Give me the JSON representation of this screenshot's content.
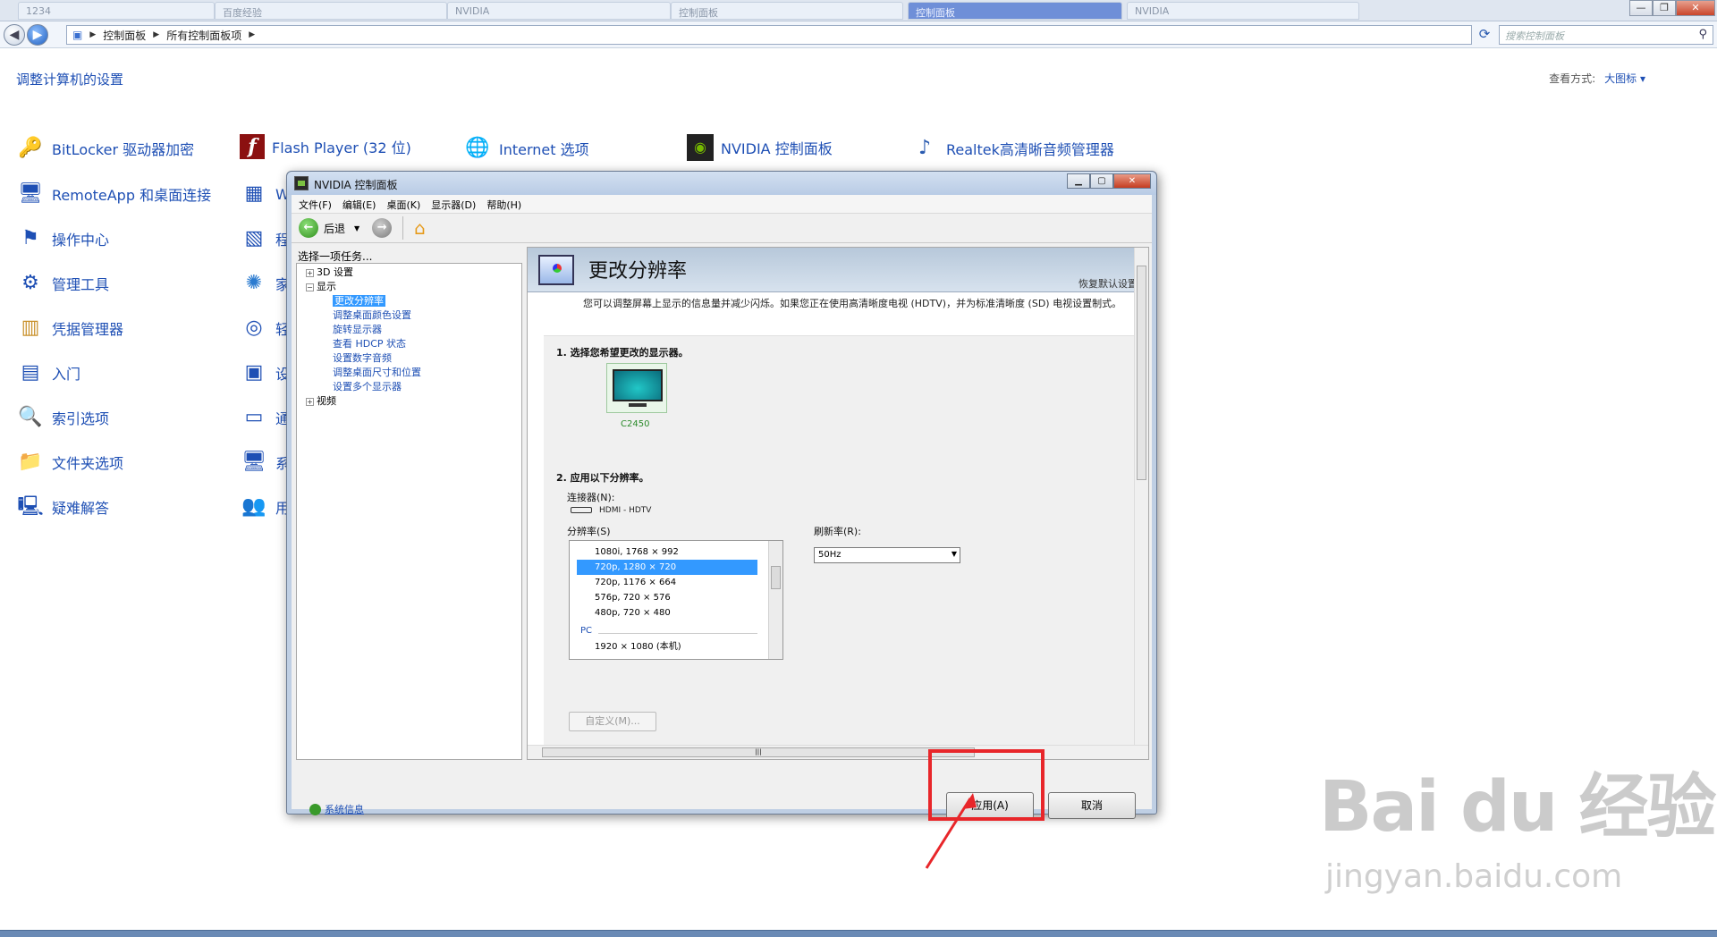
{
  "browser": {
    "tabs": [
      {
        "label": "1234",
        "active": false
      },
      {
        "label": "百度经验",
        "active": false
      },
      {
        "label": "NVIDIA",
        "active": false
      },
      {
        "label": "控制面板",
        "active": false
      },
      {
        "label": "控制面板",
        "active": true
      },
      {
        "label": "NVIDIA",
        "active": false
      }
    ],
    "window_controls": {
      "minimize": "—",
      "maximize": "❐",
      "close": "✕"
    }
  },
  "address": {
    "crumbs": [
      "控制面板",
      "所有控制面板项"
    ],
    "search_placeholder": "搜索控制面板"
  },
  "control_panel": {
    "title": "调整计算机的设置",
    "view_label": "查看方式:",
    "view_value": "大图标 ▾",
    "items_col1": [
      {
        "label": "BitLocker 驱动器加密",
        "icon": "bitlocker-icon"
      },
      {
        "label": "RemoteApp 和桌面连接",
        "icon": "remoteapp-icon"
      },
      {
        "label": "操作中心",
        "icon": "action-center-flag-icon"
      },
      {
        "label": "管理工具",
        "icon": "admin-tools-icon"
      },
      {
        "label": "凭据管理器",
        "icon": "credential-manager-icon"
      },
      {
        "label": "入门",
        "icon": "getting-started-icon"
      },
      {
        "label": "索引选项",
        "icon": "indexing-options-icon"
      },
      {
        "label": "文件夹选项",
        "icon": "folder-options-icon"
      },
      {
        "label": "疑难解答",
        "icon": "troubleshooting-icon"
      }
    ],
    "items_row1": [
      {
        "label": "Flash Player (32 位)",
        "icon": "flash-player-icon"
      },
      {
        "label": "Internet 选项",
        "icon": "internet-options-icon"
      },
      {
        "label": "NVIDIA 控制面板",
        "icon": "nvidia-icon"
      },
      {
        "label": "Realtek高清晰音频管理器",
        "icon": "realtek-audio-icon"
      }
    ],
    "col2_partial": [
      "W",
      "程",
      "家",
      "轻",
      "设",
      "通",
      "系",
      "用"
    ]
  },
  "nvidia": {
    "window_title": "NVIDIA 控制面板",
    "menu": [
      "文件(F)",
      "编辑(E)",
      "桌面(K)",
      "显示器(D)",
      "帮助(H)"
    ],
    "toolbar": {
      "back_label": "后退"
    },
    "task_header": "选择一项任务...",
    "tree": [
      {
        "label": "3D 设置",
        "type": "parent",
        "expander": "+"
      },
      {
        "label": "显示",
        "type": "parent",
        "expander": "−"
      },
      {
        "label": "更改分辨率",
        "type": "child",
        "selected": true
      },
      {
        "label": "调整桌面颜色设置",
        "type": "child",
        "selected": false
      },
      {
        "label": "旋转显示器",
        "type": "child",
        "selected": false
      },
      {
        "label": "查看 HDCP 状态",
        "type": "child",
        "selected": false
      },
      {
        "label": "设置数字音频",
        "type": "child",
        "selected": false
      },
      {
        "label": "调整桌面尺寸和位置",
        "type": "child",
        "selected": false
      },
      {
        "label": "设置多个显示器",
        "type": "child",
        "selected": false
      },
      {
        "label": "视频",
        "type": "parent",
        "expander": "+"
      }
    ],
    "pane": {
      "title": "更改分辨率",
      "restore_defaults": "恢复默认设置",
      "description": "您可以调整屏幕上显示的信息量并减少闪烁。如果您正在使用高清晰度电视 (HDTV)，并为标准清晰度 (SD) 电视设置制式。",
      "step1": "1. 选择您希望更改的显示器。",
      "monitor_name": "C2450",
      "step2": "2. 应用以下分辨率。",
      "connector_label": "连接器(N):",
      "connector_value": "HDMI - HDTV",
      "resolution_label": "分辨率(S)",
      "refresh_label": "刷新率(R):",
      "refresh_value": "50Hz",
      "resolutions": [
        {
          "label": "1080i, 1768 × 992",
          "selected": false
        },
        {
          "label": "720p, 1280 × 720",
          "selected": true
        },
        {
          "label": "720p, 1176 × 664",
          "selected": false
        },
        {
          "label": "576p, 720 × 576",
          "selected": false
        },
        {
          "label": "480p, 720 × 480",
          "selected": false
        }
      ],
      "pc_group": "PC",
      "pc_resolution": "1920 × 1080 (本机)",
      "custom_button": "自定义(M)..."
    },
    "sys_info": "系统信息",
    "apply_button": "应用(A)",
    "cancel_button": "取消"
  },
  "watermark": {
    "main": "Bai du 经验",
    "sub": "jingyan.baidu.com"
  },
  "accent_colors": {
    "link_blue": "#1e4fb4",
    "highlight_red": "#e8262a",
    "nvidia_green": "#76b900"
  }
}
